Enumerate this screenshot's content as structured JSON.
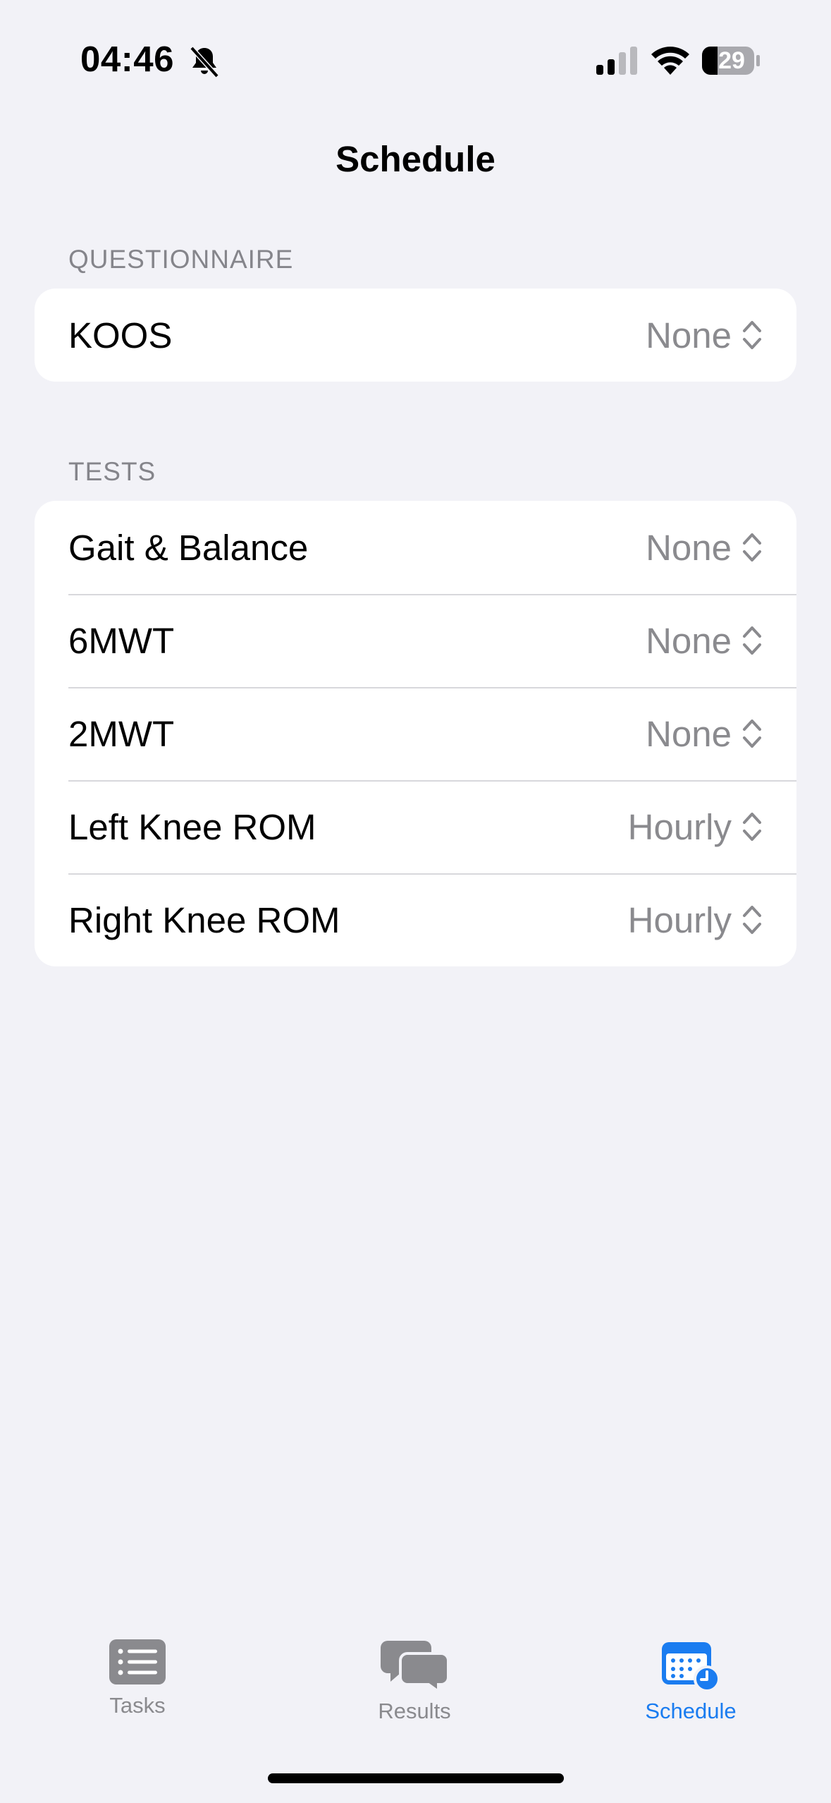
{
  "status_bar": {
    "time": "04:46",
    "battery_level": "29"
  },
  "nav": {
    "title": "Schedule"
  },
  "sections": [
    {
      "header": "QUESTIONNAIRE",
      "rows": [
        {
          "label": "KOOS",
          "value": "None"
        }
      ]
    },
    {
      "header": "TESTS",
      "rows": [
        {
          "label": "Gait & Balance",
          "value": "None"
        },
        {
          "label": "6MWT",
          "value": "None"
        },
        {
          "label": "2MWT",
          "value": "None"
        },
        {
          "label": "Left Knee ROM",
          "value": "Hourly"
        },
        {
          "label": "Right Knee ROM",
          "value": "Hourly"
        }
      ]
    }
  ],
  "tabs": [
    {
      "label": "Tasks",
      "icon": "list-icon",
      "selected": false
    },
    {
      "label": "Results",
      "icon": "chat-bubbles-icon",
      "selected": false
    },
    {
      "label": "Schedule",
      "icon": "calendar-clock-icon",
      "selected": true
    }
  ],
  "colors": {
    "background": "#f2f2f7",
    "accent": "#1a7cf0",
    "inactive_tab": "#8a8a8e",
    "secondary_text": "#8a8a8e"
  }
}
